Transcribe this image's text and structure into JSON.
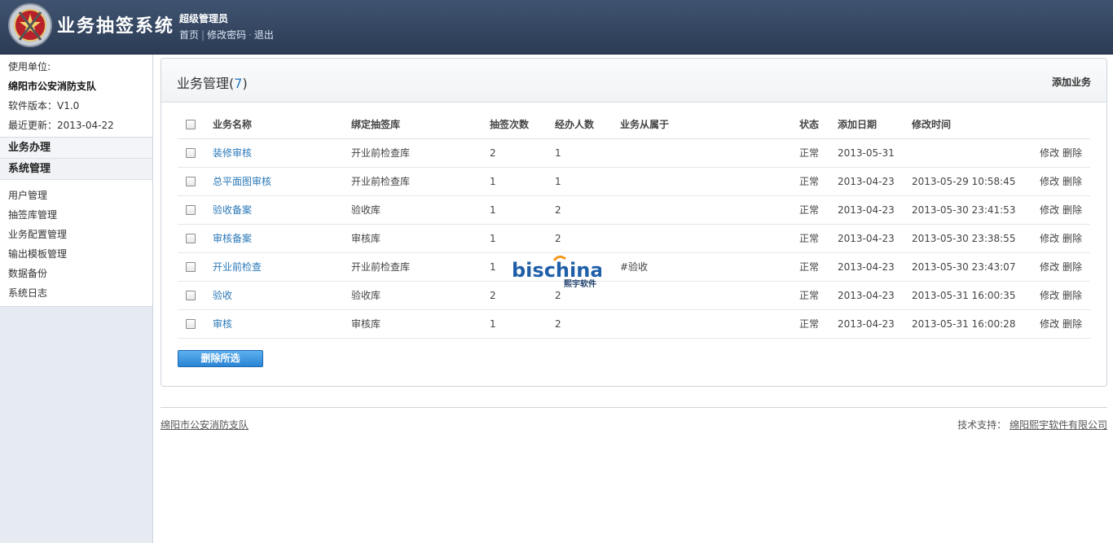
{
  "header": {
    "system_title": "业务抽签系统",
    "user_role": "超级管理员",
    "links": [
      "首页",
      "修改密码",
      "退出"
    ]
  },
  "sidebar": {
    "unit_label": "使用单位:",
    "unit_name": "绵阳市公安消防支队",
    "version": "软件版本：V1.0",
    "updated": "最近更新：2013-04-22",
    "section_business": "业务办理",
    "section_system": "系统管理",
    "items": [
      "用户管理",
      "抽签库管理",
      "业务配置管理",
      "输出模板管理",
      "数据备份",
      "系统日志"
    ]
  },
  "panel": {
    "title": "业务管理",
    "count": "7",
    "add_label": "添加业务",
    "delete_selected": "删除所选"
  },
  "table": {
    "headers": [
      "业务名称",
      "绑定抽签库",
      "抽签次数",
      "经办人数",
      "业务从属于",
      "状态",
      "添加日期",
      "修改时间"
    ],
    "edit_label": "修改",
    "delete_label": "删除",
    "rows": [
      {
        "name": "装修审核",
        "library": "开业前检查库",
        "draws": "2",
        "handlers": "1",
        "belongs": "",
        "status": "正常",
        "added": "2013-05-31",
        "modified": ""
      },
      {
        "name": "总平面图审核",
        "library": "开业前检查库",
        "draws": "1",
        "handlers": "1",
        "belongs": "",
        "status": "正常",
        "added": "2013-04-23",
        "modified": "2013-05-29 10:58:45"
      },
      {
        "name": "验收备案",
        "library": "验收库",
        "draws": "1",
        "handlers": "2",
        "belongs": "",
        "status": "正常",
        "added": "2013-04-23",
        "modified": "2013-05-30 23:41:53"
      },
      {
        "name": "审核备案",
        "library": "审核库",
        "draws": "1",
        "handlers": "2",
        "belongs": "",
        "status": "正常",
        "added": "2013-04-23",
        "modified": "2013-05-30 23:38:55"
      },
      {
        "name": "开业前检查",
        "library": "开业前检查库",
        "draws": "1",
        "handlers": "",
        "belongs": "#验收",
        "status": "正常",
        "added": "2013-04-23",
        "modified": "2013-05-30 23:43:07"
      },
      {
        "name": "验收",
        "library": "验收库",
        "draws": "2",
        "handlers": "2",
        "belongs": "",
        "status": "正常",
        "added": "2013-04-23",
        "modified": "2013-05-31 16:00:35"
      },
      {
        "name": "审核",
        "library": "审核库",
        "draws": "1",
        "handlers": "2",
        "belongs": "",
        "status": "正常",
        "added": "2013-04-23",
        "modified": "2013-05-31 16:00:28"
      }
    ]
  },
  "watermark": {
    "brand": "bischina",
    "sub": "熙宇软件"
  },
  "footer": {
    "left": "绵阳市公安消防支队",
    "support_label": "技术支持：",
    "support_link": "绵阳熙宇软件有限公司"
  },
  "colors": {
    "header_bg": "#34465f",
    "link": "#2a78b8",
    "button": "#2a84d4"
  }
}
